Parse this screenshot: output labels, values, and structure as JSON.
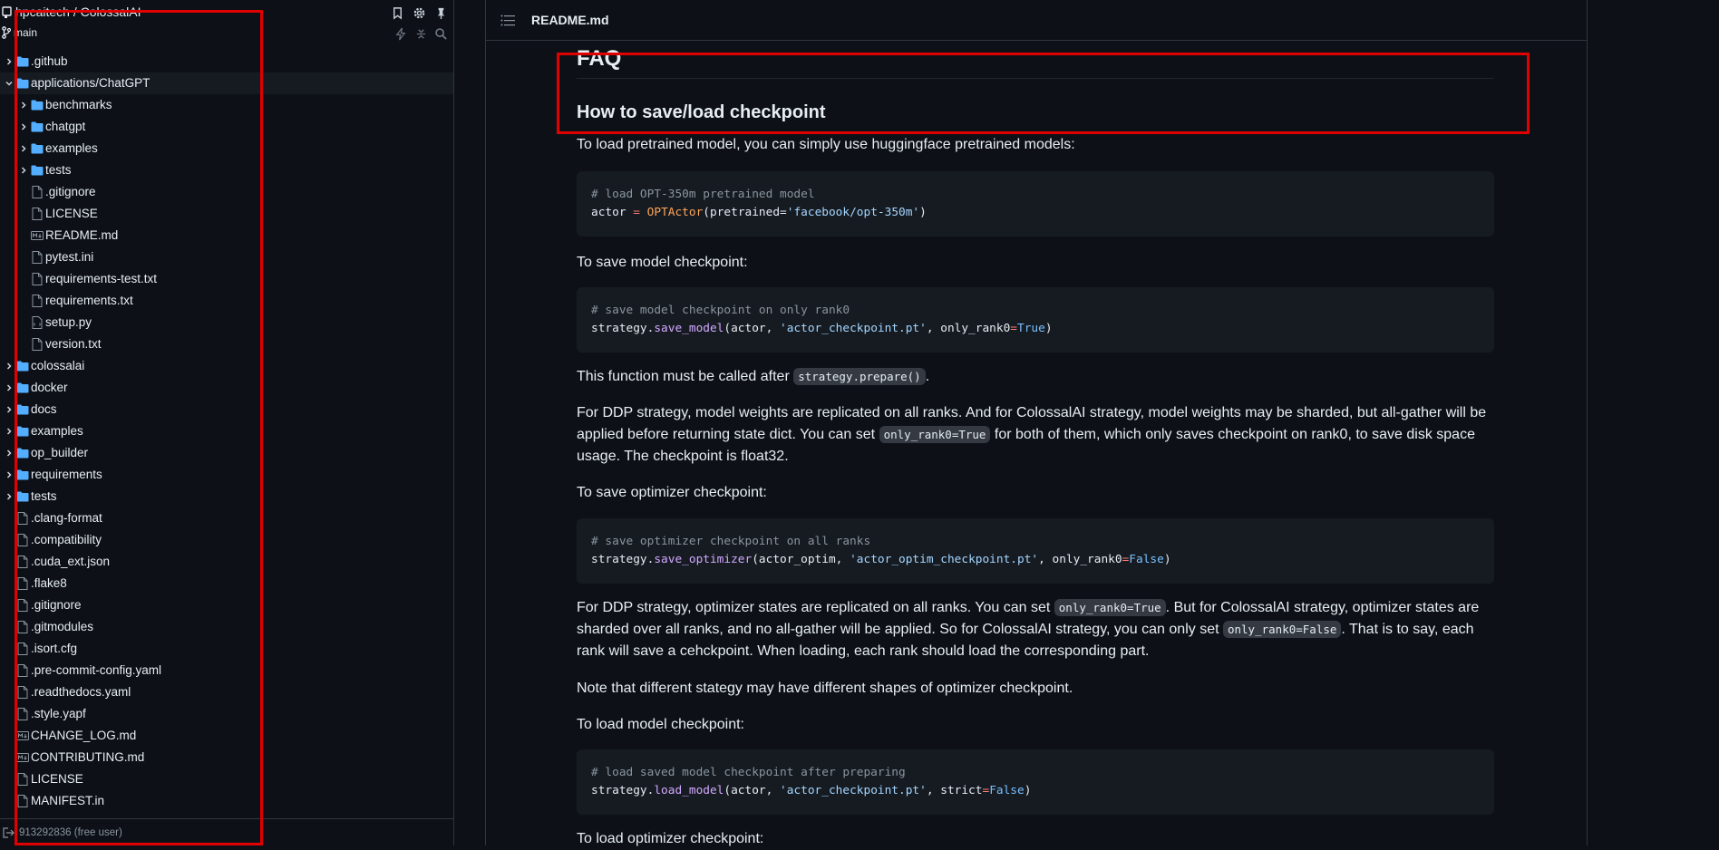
{
  "sidebar": {
    "repo": "hpcaitech / ColossalAI",
    "branch": "main",
    "footer_user": "913292836 (free user)",
    "tree": [
      {
        "label": ".github",
        "type": "folder",
        "depth": 0,
        "expanded": false
      },
      {
        "label": "applications/ChatGPT",
        "type": "folder",
        "depth": 0,
        "expanded": true,
        "selected": true
      },
      {
        "label": "benchmarks",
        "type": "folder",
        "depth": 1,
        "expanded": false
      },
      {
        "label": "chatgpt",
        "type": "folder",
        "depth": 1,
        "expanded": false
      },
      {
        "label": "examples",
        "type": "folder",
        "depth": 1,
        "expanded": false
      },
      {
        "label": "tests",
        "type": "folder",
        "depth": 1,
        "expanded": false
      },
      {
        "label": ".gitignore",
        "type": "file",
        "depth": 1
      },
      {
        "label": "LICENSE",
        "type": "file",
        "depth": 1
      },
      {
        "label": "README.md",
        "type": "markdown",
        "depth": 1
      },
      {
        "label": "pytest.ini",
        "type": "file",
        "depth": 1
      },
      {
        "label": "requirements-test.txt",
        "type": "file",
        "depth": 1
      },
      {
        "label": "requirements.txt",
        "type": "file",
        "depth": 1
      },
      {
        "label": "setup.py",
        "type": "script",
        "depth": 1
      },
      {
        "label": "version.txt",
        "type": "file",
        "depth": 1
      },
      {
        "label": "colossalai",
        "type": "folder",
        "depth": 0,
        "expanded": false
      },
      {
        "label": "docker",
        "type": "folder",
        "depth": 0,
        "expanded": false
      },
      {
        "label": "docs",
        "type": "folder",
        "depth": 0,
        "expanded": false
      },
      {
        "label": "examples",
        "type": "folder",
        "depth": 0,
        "expanded": false
      },
      {
        "label": "op_builder",
        "type": "folder",
        "depth": 0,
        "expanded": false
      },
      {
        "label": "requirements",
        "type": "folder",
        "depth": 0,
        "expanded": false
      },
      {
        "label": "tests",
        "type": "folder",
        "depth": 0,
        "expanded": false
      },
      {
        "label": ".clang-format",
        "type": "file",
        "depth": 0
      },
      {
        "label": ".compatibility",
        "type": "file",
        "depth": 0
      },
      {
        "label": ".cuda_ext.json",
        "type": "file",
        "depth": 0
      },
      {
        "label": ".flake8",
        "type": "file",
        "depth": 0
      },
      {
        "label": ".gitignore",
        "type": "file",
        "depth": 0
      },
      {
        "label": ".gitmodules",
        "type": "file",
        "depth": 0
      },
      {
        "label": ".isort.cfg",
        "type": "file",
        "depth": 0
      },
      {
        "label": ".pre-commit-config.yaml",
        "type": "file",
        "depth": 0
      },
      {
        "label": ".readthedocs.yaml",
        "type": "file",
        "depth": 0
      },
      {
        "label": ".style.yapf",
        "type": "file",
        "depth": 0
      },
      {
        "label": "CHANGE_LOG.md",
        "type": "markdown",
        "depth": 0
      },
      {
        "label": "CONTRIBUTING.md",
        "type": "markdown",
        "depth": 0
      },
      {
        "label": "LICENSE",
        "type": "file",
        "depth": 0
      },
      {
        "label": "MANIFEST.in",
        "type": "file",
        "depth": 0
      }
    ]
  },
  "main": {
    "file_name": "README.md",
    "faq_heading": "FAQ",
    "h3": "How to save/load checkpoint",
    "p1": "To load pretrained model, you can simply use huggingface pretrained models:",
    "code1": {
      "comment": "# load OPT-350m pretrained model",
      "var": "actor",
      "op": " = ",
      "cls": "OPTActor",
      "arg1": "(pretrained=",
      "str1": "'facebook/opt-350m'",
      "end": ")"
    },
    "p2": "To save model checkpoint:",
    "code2": {
      "comment": "# save model checkpoint on only rank0",
      "obj": "strategy.",
      "fn": "save_model",
      "args": "(actor, ",
      "str1": "'actor_checkpoint.pt'",
      "kwarg": ", only_rank0",
      "eq": "=",
      "val": "True",
      "end": ")"
    },
    "p3_pre": "This function must be called after ",
    "p3_code": "strategy.prepare()",
    "p3_post": ".",
    "p4_a": "For DDP strategy, model weights are replicated on all ranks. And for ColossalAI strategy, model weights may be sharded, but all-gather will be applied before returning state dict. You can set ",
    "p4_code": "only_rank0=True",
    "p4_b": " for both of them, which only saves checkpoint on rank0, to save disk space usage. The checkpoint is float32.",
    "p5": "To save optimizer checkpoint:",
    "code3": {
      "comment": "# save optimizer checkpoint on all ranks",
      "obj": "strategy.",
      "fn": "save_optimizer",
      "args": "(actor_optim, ",
      "str1": "'actor_optim_checkpoint.pt'",
      "kwarg": ", only_rank0",
      "eq": "=",
      "val": "False",
      "end": ")"
    },
    "p6_a": "For DDP strategy, optimizer states are replicated on all ranks. You can set ",
    "p6_code1": "only_rank0=True",
    "p6_b": ". But for ColossalAI strategy, optimizer states are sharded over all ranks, and no all-gather will be applied. So for ColossalAI strategy, you can only set ",
    "p6_code2": "only_rank0=False",
    "p6_c": ". That is to say, each rank will save a cehckpoint. When loading, each rank should load the corresponding part.",
    "p7": "Note that different stategy may have different shapes of optimizer checkpoint.",
    "p8": "To load model checkpoint:",
    "code4": {
      "comment": "# load saved model checkpoint after preparing",
      "obj": "strategy.",
      "fn": "load_model",
      "args": "(actor, ",
      "str1": "'actor_checkpoint.pt'",
      "kwarg": ", strict",
      "eq": "=",
      "val": "False",
      "end": ")"
    },
    "p9": "To load optimizer checkpoint:"
  },
  "colors": {
    "background": "#0d1117",
    "folder_icon": "#54aeff",
    "highlight_box": "#e00000"
  },
  "icons": [
    "repo-icon",
    "bookmark-icon",
    "gear-icon",
    "pin-icon",
    "branch-icon",
    "lightning-icon",
    "collapse-icon",
    "search-icon",
    "list-icon",
    "logout-icon"
  ]
}
